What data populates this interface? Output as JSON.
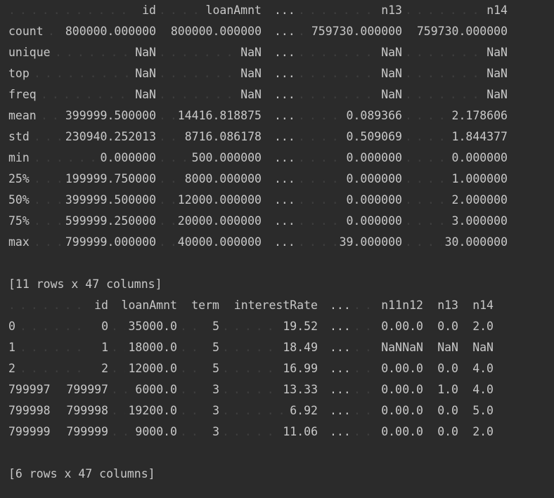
{
  "table1": {
    "columns": [
      "id",
      "loanAmnt",
      "...",
      "n13",
      "n14"
    ],
    "rows": [
      {
        "index": "count",
        "values": [
          "800000.000000",
          "800000.000000",
          "...",
          "759730.000000",
          "759730.000000"
        ]
      },
      {
        "index": "unique",
        "values": [
          "NaN",
          "NaN",
          "...",
          "NaN",
          "NaN"
        ]
      },
      {
        "index": "top",
        "values": [
          "NaN",
          "NaN",
          "...",
          "NaN",
          "NaN"
        ]
      },
      {
        "index": "freq",
        "values": [
          "NaN",
          "NaN",
          "...",
          "NaN",
          "NaN"
        ]
      },
      {
        "index": "mean",
        "values": [
          "399999.500000",
          "14416.818875",
          "...",
          "0.089366",
          "2.178606"
        ]
      },
      {
        "index": "std",
        "values": [
          "230940.252013",
          "8716.086178",
          "...",
          "0.509069",
          "1.844377"
        ]
      },
      {
        "index": "min",
        "values": [
          "0.000000",
          "500.000000",
          "...",
          "0.000000",
          "0.000000"
        ]
      },
      {
        "index": "25%",
        "values": [
          "199999.750000",
          "8000.000000",
          "...",
          "0.000000",
          "1.000000"
        ]
      },
      {
        "index": "50%",
        "values": [
          "399999.500000",
          "12000.000000",
          "...",
          "0.000000",
          "2.000000"
        ]
      },
      {
        "index": "75%",
        "values": [
          "599999.250000",
          "20000.000000",
          "...",
          "0.000000",
          "3.000000"
        ]
      },
      {
        "index": "max",
        "values": [
          "799999.000000",
          "40000.000000",
          "...",
          "39.000000",
          "30.000000"
        ]
      }
    ],
    "summary": "[11 rows x 47 columns]"
  },
  "table2": {
    "columns": [
      "id",
      "loanAmnt",
      "term",
      "interestRate",
      "...",
      "n11",
      "n12",
      "n13",
      "n14"
    ],
    "rows": [
      {
        "index": "0",
        "values": [
          "0",
          "35000.0",
          "5",
          "19.52",
          "...",
          "0.0",
          "0.0",
          "0.0",
          "2.0"
        ]
      },
      {
        "index": "1",
        "values": [
          "1",
          "18000.0",
          "5",
          "18.49",
          "...",
          "NaN",
          "NaN",
          "NaN",
          "NaN"
        ]
      },
      {
        "index": "2",
        "values": [
          "2",
          "12000.0",
          "5",
          "16.99",
          "...",
          "0.0",
          "0.0",
          "0.0",
          "4.0"
        ]
      },
      {
        "index": "799997",
        "values": [
          "799997",
          "6000.0",
          "3",
          "13.33",
          "...",
          "0.0",
          "0.0",
          "1.0",
          "4.0"
        ]
      },
      {
        "index": "799998",
        "values": [
          "799998",
          "19200.0",
          "3",
          "6.92",
          "...",
          "0.0",
          "0.0",
          "0.0",
          "5.0"
        ]
      },
      {
        "index": "799999",
        "values": [
          "799999",
          "9000.0",
          "3",
          "11.06",
          "...",
          "0.0",
          "0.0",
          "0.0",
          "2.0"
        ]
      }
    ],
    "summary": "[6 rows x 47 columns]"
  },
  "colors": {
    "background": "#2b2b2b",
    "text": "#c8c8c8",
    "dots": "#3f3f3f"
  }
}
